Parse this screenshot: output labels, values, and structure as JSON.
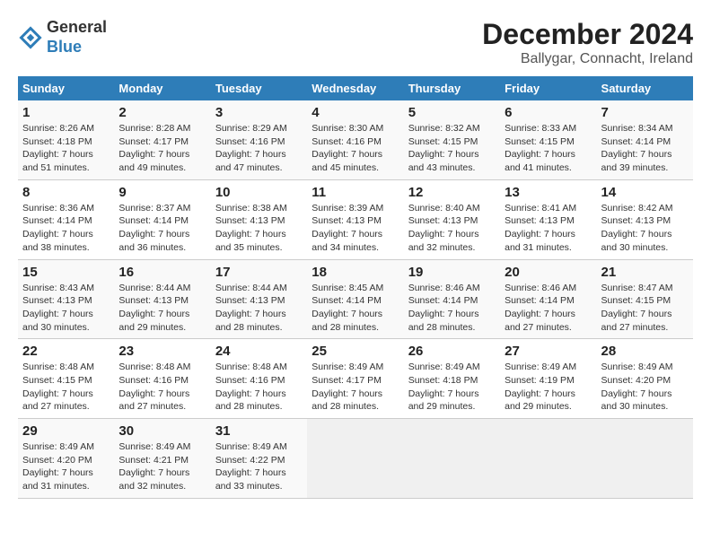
{
  "header": {
    "logo_general": "General",
    "logo_blue": "Blue",
    "month_title": "December 2024",
    "location": "Ballygar, Connacht, Ireland"
  },
  "calendar": {
    "days_of_week": [
      "Sunday",
      "Monday",
      "Tuesday",
      "Wednesday",
      "Thursday",
      "Friday",
      "Saturday"
    ],
    "weeks": [
      [
        null,
        null,
        null,
        null,
        null,
        null,
        null
      ]
    ]
  },
  "days": [
    {
      "num": "",
      "sunrise": "",
      "sunset": "",
      "daylight": ""
    },
    {
      "num": "",
      "sunrise": "",
      "sunset": "",
      "daylight": ""
    },
    {
      "num": "",
      "sunrise": "",
      "sunset": "",
      "daylight": ""
    },
    {
      "num": "",
      "sunrise": "",
      "sunset": "",
      "daylight": ""
    },
    {
      "num": "",
      "sunrise": "",
      "sunset": "",
      "daylight": ""
    },
    {
      "num": "",
      "sunrise": "",
      "sunset": "",
      "daylight": ""
    },
    {
      "num": "",
      "sunrise": "",
      "sunset": "",
      "daylight": ""
    }
  ]
}
